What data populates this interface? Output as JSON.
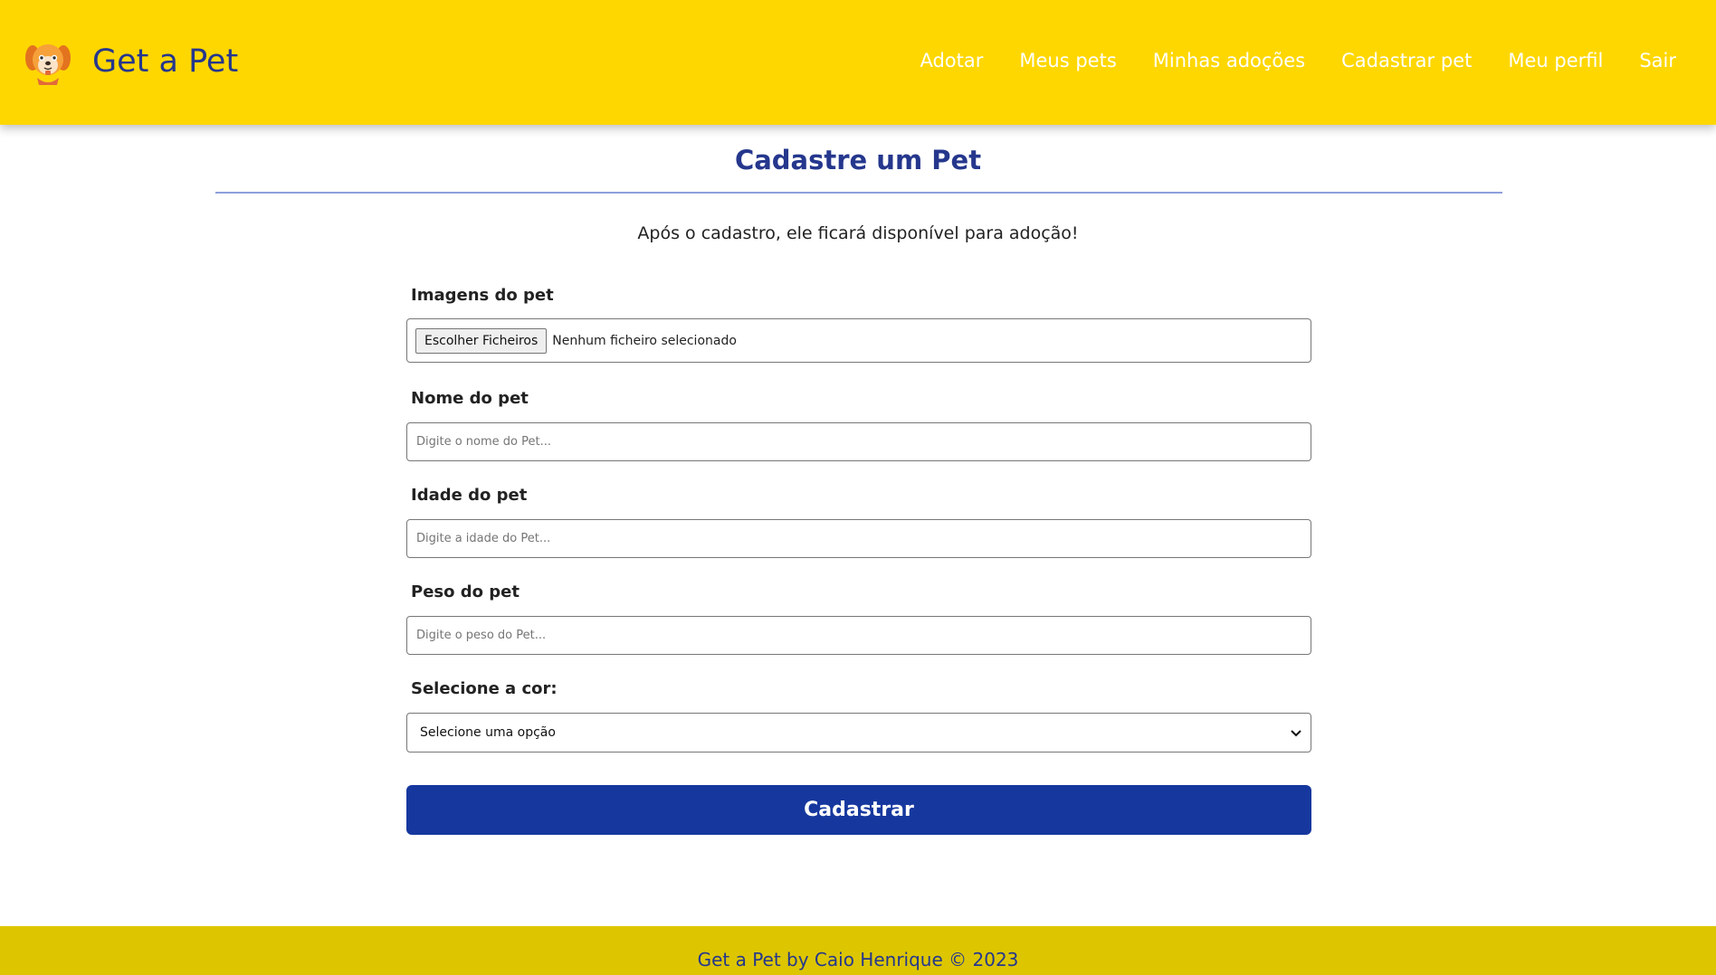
{
  "nav": {
    "brand": "Get a Pet",
    "logo_icon": "dog-face-icon",
    "links": [
      "Adotar",
      "Meus pets",
      "Minhas adoções",
      "Cadastrar pet",
      "Meu perfil",
      "Sair"
    ]
  },
  "page": {
    "title": "Cadastre um Pet",
    "subtitle": "Após o cadastro, ele ficará disponível para adoção!"
  },
  "form": {
    "images": {
      "label": "Imagens do pet",
      "button_label": "Escolher Ficheiros",
      "status": "Nenhum ficheiro selecionado"
    },
    "name": {
      "label": "Nome do pet",
      "placeholder": "Digite o nome do Pet...",
      "value": ""
    },
    "age": {
      "label": "Idade do pet",
      "placeholder": "Digite a idade do Pet...",
      "value": ""
    },
    "weight": {
      "label": "Peso do pet",
      "placeholder": "Digite o peso do Pet...",
      "value": ""
    },
    "color": {
      "label": "Selecione a cor:",
      "selected": "Selecione uma opção"
    },
    "submit_label": "Cadastrar"
  },
  "footer": {
    "text": "Get a Pet by Caio Henrique © 2023"
  },
  "colors": {
    "navbar": "#FFD700",
    "brand_text": "#25378D",
    "divider": "#8D9FDB",
    "button": "#16389E",
    "footer": "#DDC600"
  }
}
